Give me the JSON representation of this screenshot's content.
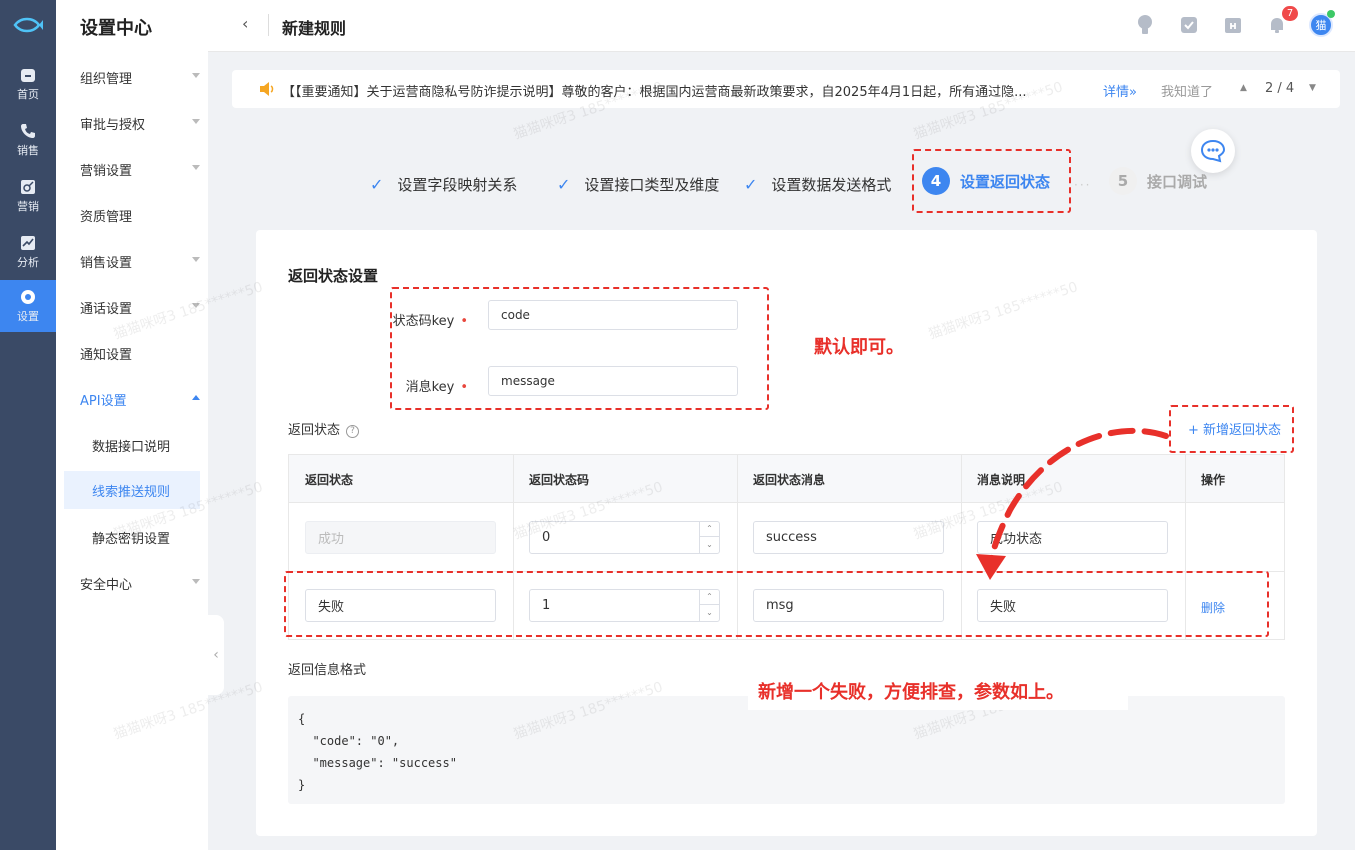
{
  "rail": {
    "items": [
      {
        "label": "首页",
        "icon": "home-icon"
      },
      {
        "label": "销售",
        "icon": "phone-icon"
      },
      {
        "label": "营销",
        "icon": "marketing-icon"
      },
      {
        "label": "分析",
        "icon": "chart-icon"
      },
      {
        "label": "设置",
        "icon": "settings-icon"
      }
    ]
  },
  "nav": {
    "title": "设置中心",
    "items": [
      {
        "label": "组织管理"
      },
      {
        "label": "审批与授权"
      },
      {
        "label": "营销设置"
      },
      {
        "label": "资质管理"
      },
      {
        "label": "销售设置"
      },
      {
        "label": "通话设置"
      },
      {
        "label": "通知设置"
      },
      {
        "label": "API设置"
      },
      {
        "label": "数据接口说明"
      },
      {
        "label": "线索推送规则"
      },
      {
        "label": "静态密钥设置"
      },
      {
        "label": "安全中心"
      }
    ]
  },
  "header": {
    "back": "‹",
    "title": "新建规则",
    "badge_count": "7",
    "avatar_text": "猫"
  },
  "notice": {
    "text": "【【重要通知】关于运营商隐私号防诈提示说明】尊敬的客户：根据国内运营商最新政策要求，自2025年4月1日起，所有通过隐...",
    "detail": "详情»",
    "ack": "我知道了",
    "up": "▲",
    "page": "2 / 4",
    "down": "▼"
  },
  "steps": [
    {
      "label": "设置字段映射关系",
      "check": "✓"
    },
    {
      "label": "设置接口类型及维度",
      "check": "✓"
    },
    {
      "label": "设置数据发送格式",
      "check": "✓"
    },
    {
      "label": "设置返回状态",
      "num": "4"
    },
    {
      "label": "接口调试",
      "num": "5"
    }
  ],
  "step_dots": "···",
  "form": {
    "section_title": "返回状态设置",
    "status_key_label": "状态码key",
    "status_key_value": "code",
    "message_key_label": "消息key",
    "message_key_value": "message",
    "required_mark": "•"
  },
  "table": {
    "label": "返回状态",
    "help": "?",
    "add_label": "+ 新增返回状态",
    "columns": [
      "返回状态",
      "返回状态码",
      "返回状态消息",
      "消息说明",
      "操作"
    ],
    "rows": [
      {
        "status": "成功",
        "code": "0",
        "message": "success",
        "desc": "成功状态",
        "action": ""
      },
      {
        "status": "失败",
        "code": "1",
        "message": "msg",
        "desc": "失败",
        "action": "删除"
      }
    ],
    "stepper_up": "⌃",
    "stepper_down": "⌄"
  },
  "format": {
    "label": "返回信息格式",
    "code": "{\n  \"code\": \"0\",\n  \"message\": \"success\"\n}"
  },
  "annotations": {
    "default_ok": "默认即可。",
    "add_fail": "新增一个失败，方便排查，参数如上。"
  },
  "watermark": "猫猫咪呀3 185******50",
  "colors": {
    "accent": "#3d86f0",
    "rail": "#3a4a66",
    "annotation": "#e8302a"
  }
}
